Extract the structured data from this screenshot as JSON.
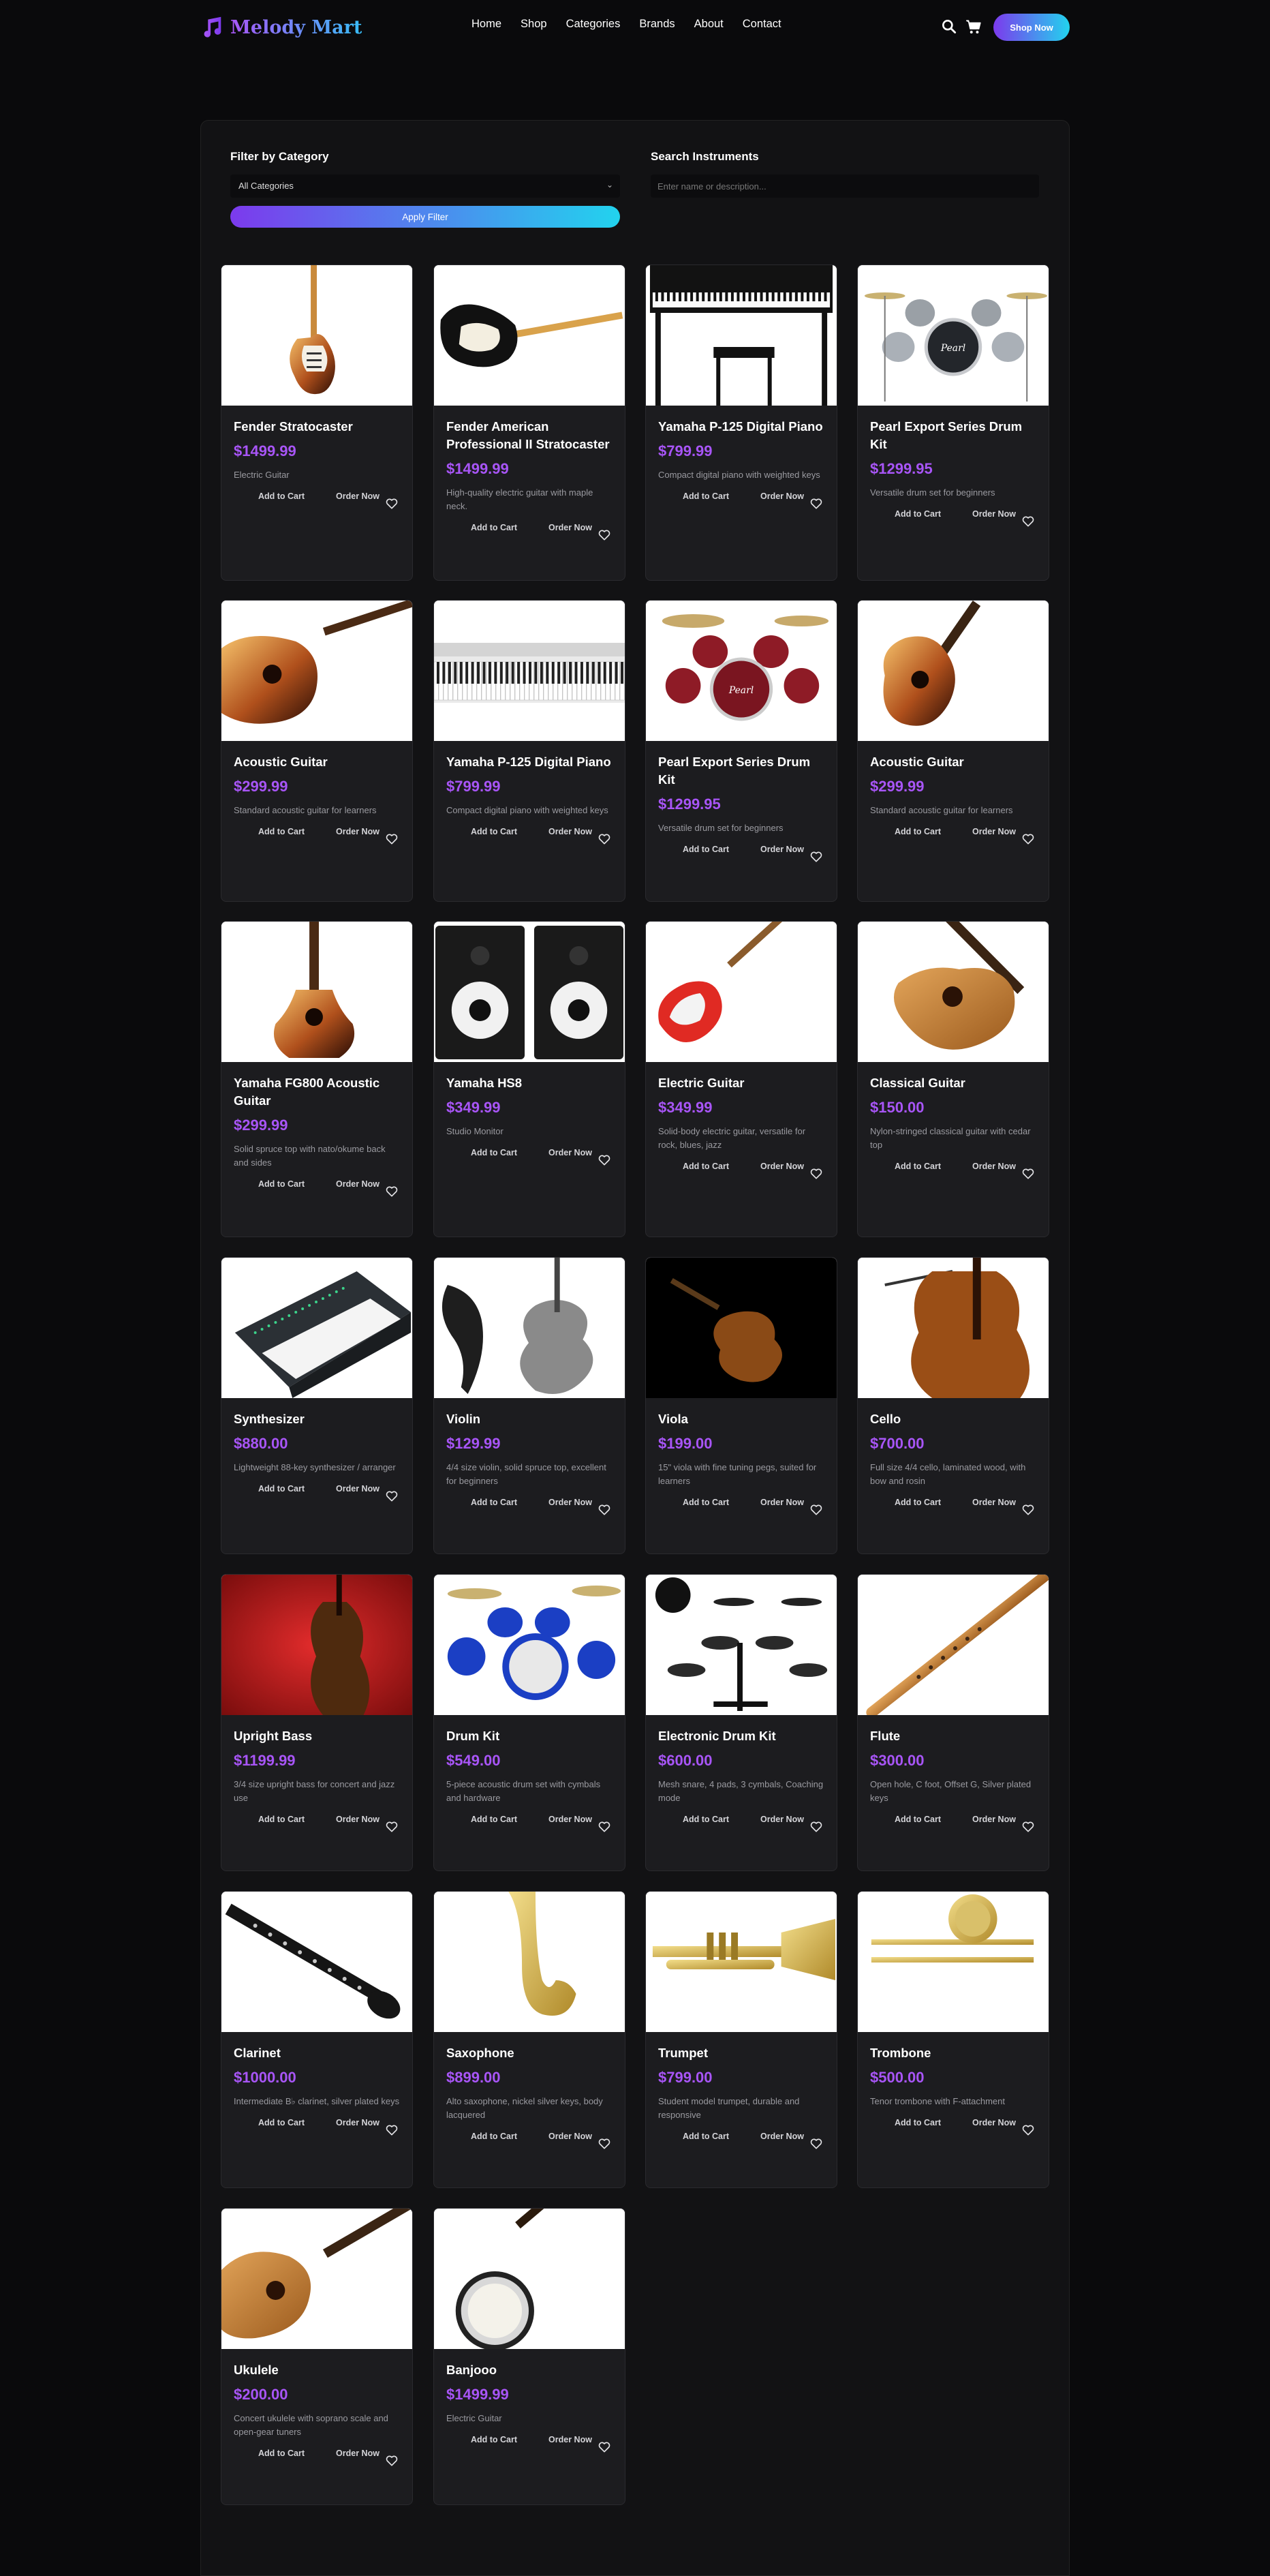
{
  "nav": {
    "brand": "Melody Mart",
    "menu": [
      "Home",
      "Shop",
      "Categories",
      "Brands",
      "About",
      "Contact"
    ],
    "shop_now": "Shop Now",
    "icons": [
      "search-icon",
      "cart-icon"
    ]
  },
  "filter": {
    "title": "Filter by Category",
    "selected": "All Categories",
    "apply": "Apply Filter"
  },
  "search": {
    "title": "Search Instruments",
    "placeholder": "Enter name or description..."
  },
  "actions": {
    "add": "Add to Cart",
    "order": "Order Now"
  },
  "colors": {
    "accent": "#a855f7",
    "gradient_start": "#7c3aed",
    "gradient_end": "#22d3ee"
  },
  "products": [
    {
      "title": "Fender Stratocaster",
      "price": "$1499.99",
      "desc": "Electric Guitar",
      "image": "strat-guitar"
    },
    {
      "title": "Fender American Professional II Stratocaster",
      "price": "$1499.99",
      "desc": "High-quality electric guitar with maple neck.",
      "image": "black-strat"
    },
    {
      "title": "Yamaha P-125 Digital Piano",
      "price": "$799.99",
      "desc": "Compact digital piano with weighted keys",
      "image": "digital-piano"
    },
    {
      "title": "Pearl Export Series Drum Kit",
      "price": "$1299.95",
      "desc": "Versatile drum set for beginners",
      "image": "drum-kit-silver"
    },
    {
      "title": "Acoustic Guitar",
      "price": "$299.99",
      "desc": "Standard acoustic guitar for learners",
      "image": "acoustic-guitar-lying"
    },
    {
      "title": "Yamaha P-125 Digital Piano",
      "price": "$799.99",
      "desc": "Compact digital piano with weighted keys",
      "image": "piano-keys"
    },
    {
      "title": "Pearl Export Series Drum Kit",
      "price": "$1299.95",
      "desc": "Versatile drum set for beginners",
      "image": "drum-kit-red"
    },
    {
      "title": "Acoustic Guitar",
      "price": "$299.99",
      "desc": "Standard acoustic guitar for learners",
      "image": "acoustic-guitar-sunburst"
    },
    {
      "title": "Yamaha FG800 Acoustic Guitar",
      "price": "$299.99",
      "desc": "Solid spruce top with nato/okume back and sides",
      "image": "acoustic-upright"
    },
    {
      "title": "Yamaha HS8",
      "price": "$349.99",
      "desc": "Studio Monitor",
      "image": "studio-monitors"
    },
    {
      "title": "Electric Guitar",
      "price": "$349.99",
      "desc": "Solid-body electric guitar, versatile for rock, blues, jazz",
      "image": "red-electric"
    },
    {
      "title": "Classical Guitar",
      "price": "$150.00",
      "desc": "Nylon-stringed classical guitar with cedar top",
      "image": "classical-guitar"
    },
    {
      "title": "Synthesizer",
      "price": "$880.00",
      "desc": "Lightweight 88-key synthesizer / arranger",
      "image": "synthesizer"
    },
    {
      "title": "Violin",
      "price": "$129.99",
      "desc": "4/4 size violin, solid spruce top, excellent for beginners",
      "image": "violin-bw"
    },
    {
      "title": "Viola",
      "price": "$199.00",
      "desc": "15\" viola with fine tuning pegs, suited for learners",
      "image": "viola-dark"
    },
    {
      "title": "Cello",
      "price": "$700.00",
      "desc": "Full size 4/4 cello, laminated wood, with bow and rosin",
      "image": "cello"
    },
    {
      "title": "Upright Bass",
      "price": "$1199.99",
      "desc": "3/4 size upright bass for concert and jazz use",
      "image": "upright-bass-red"
    },
    {
      "title": "Drum Kit",
      "price": "$549.00",
      "desc": "5-piece acoustic drum set with cymbals and hardware",
      "image": "drum-kit-blue"
    },
    {
      "title": "Electronic Drum Kit",
      "price": "$600.00",
      "desc": "Mesh snare, 4 pads, 3 cymbals, Coaching mode",
      "image": "electronic-drums"
    },
    {
      "title": "Flute",
      "price": "$300.00",
      "desc": "Open hole, C foot, Offset G, Silver plated keys",
      "image": "wooden-flute"
    },
    {
      "title": "Clarinet",
      "price": "$1000.00",
      "desc": "Intermediate B♭ clarinet, silver plated keys",
      "image": "clarinet"
    },
    {
      "title": "Saxophone",
      "price": "$899.00",
      "desc": "Alto saxophone, nickel silver keys, body lacquered",
      "image": "saxophone"
    },
    {
      "title": "Trumpet",
      "price": "$799.00",
      "desc": "Student model trumpet, durable and responsive",
      "image": "trumpet"
    },
    {
      "title": "Trombone",
      "price": "$500.00",
      "desc": "Tenor trombone with F-attachment",
      "image": "trombone"
    },
    {
      "title": "Ukulele",
      "price": "$200.00",
      "desc": "Concert ukulele with soprano scale and open-gear tuners",
      "image": "ukulele"
    },
    {
      "title": "Banjooo",
      "price": "$1499.99",
      "desc": "Electric Guitar",
      "image": "banjo"
    }
  ]
}
